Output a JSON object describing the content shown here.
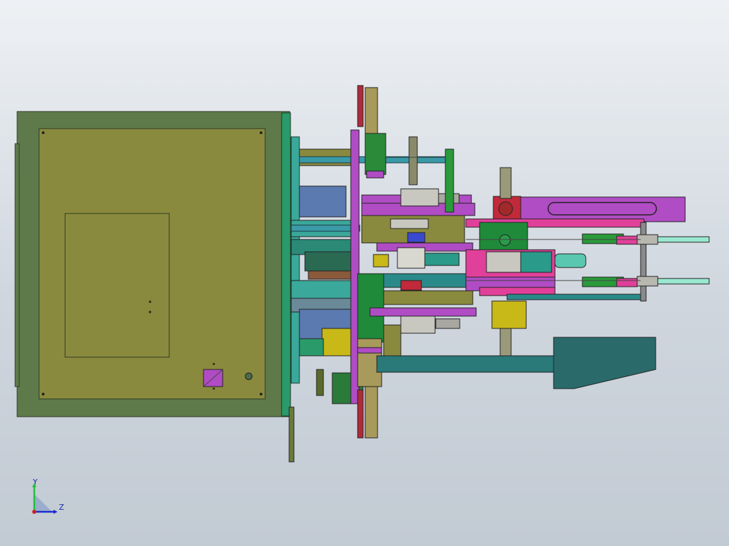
{
  "view": {
    "background_top": "#eef1f4",
    "background_bottom": "#c2cad3"
  },
  "triad": {
    "y_label": "Y",
    "z_label": "Z",
    "y_color": "#1fbf3a",
    "z_color": "#1a2ad0",
    "x_color": "#d02020"
  },
  "palette": {
    "frame": "#5f7a4a",
    "plate": "#8a8a3e",
    "teal": "#2a8a86",
    "green": "#1f8a3a",
    "magenta": "#b04cc4",
    "blue": "#3a6ad0",
    "red": "#c02a3a",
    "pink": "#e0409a",
    "yellow": "#c8b818"
  }
}
